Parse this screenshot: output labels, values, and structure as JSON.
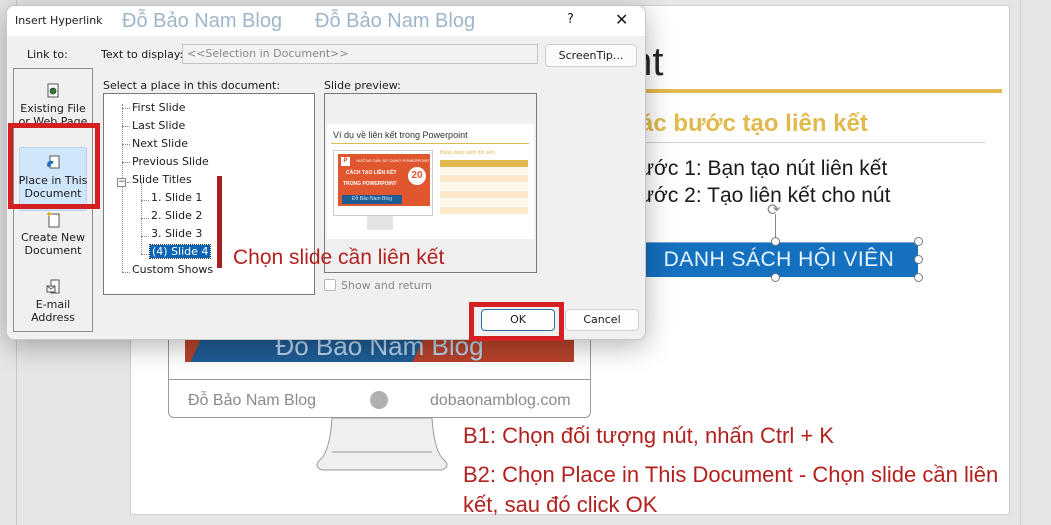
{
  "dialog": {
    "title": "Insert Hyperlink",
    "watermark": "Đỗ Bảo Nam Blog",
    "help_label": "?",
    "close_label": "✕",
    "link_to_label": "Link to:",
    "text_to_display_label": "Text to display:",
    "text_to_display_value": "<<Selection in Document>>",
    "screentip_label": "ScreenTip...",
    "link_to_items": [
      {
        "label_line1": "Existing File",
        "label_line2": "or Web Page",
        "icon": "web-page-icon",
        "selected": false
      },
      {
        "label_line1": "Place in This",
        "label_line2": "Document",
        "icon": "place-in-document-icon",
        "selected": true
      },
      {
        "label_line1": "Create New",
        "label_line2": "Document",
        "icon": "new-document-icon",
        "selected": false
      },
      {
        "label_line1": "E-mail",
        "label_line2": "Address",
        "icon": "email-icon",
        "selected": false
      }
    ],
    "select_place_label": "Select a place in this document:",
    "tree": {
      "top_items": [
        "First Slide",
        "Last Slide",
        "Next Slide",
        "Previous Slide"
      ],
      "group_label": "Slide Titles",
      "group_expander": "−",
      "children": [
        "1. Slide 1",
        "2. Slide 2",
        "3. Slide 3",
        "(4) Slide 4"
      ],
      "selected_child": "(4) Slide 4",
      "last_item": "Custom Shows"
    },
    "slide_preview_label": "Slide preview:",
    "preview": {
      "title": "Ví dụ về liên kết trong Powerpoint",
      "screen_line1": "HƯỚNG DẪN SỬ DỤNG POWERPOINT",
      "screen_line2": "CÁCH TẠO LIÊN KẾT",
      "screen_line3": "TRONG POWERPOINT",
      "screen_number": "20",
      "screen_pp": "P",
      "screen_blog": "Đỗ Bảo Nam Blog",
      "table_title": "Bảng danh sách hội viên"
    },
    "show_and_return_label": "Show and return",
    "show_and_return_checked": false,
    "ok_label": "OK",
    "cancel_label": "Cancel"
  },
  "annotation": {
    "choose_slide": "Chọn slide cần liên kết"
  },
  "slide": {
    "title": "owerpoint",
    "subtitle": "ác bước tạo liên kết",
    "step1": "ước 1: Bạn tạo nút liên kết",
    "step2": "ước 2: Tạo liên kết cho nút",
    "button_label": "DANH SÁCH HỘI VIÊN",
    "monitor_banner": "Đỗ Bảo Nam Blog",
    "monitor_left": "Đỗ Bảo Nam Blog",
    "monitor_right": "dobaonamblog.com",
    "note_b1": "B1: Chọn đối tượng nút, nhấn Ctrl + K",
    "note_b2": "B2: Chọn Place in This Document - Chọn slide cần liên kết, sau đó click OK"
  },
  "colors": {
    "accent_gold": "#e2b94c",
    "button_blue": "#1570c0",
    "annotation_red": "#b3211e",
    "highlight_red": "#d42020",
    "selection_blue": "#0a64b4"
  }
}
